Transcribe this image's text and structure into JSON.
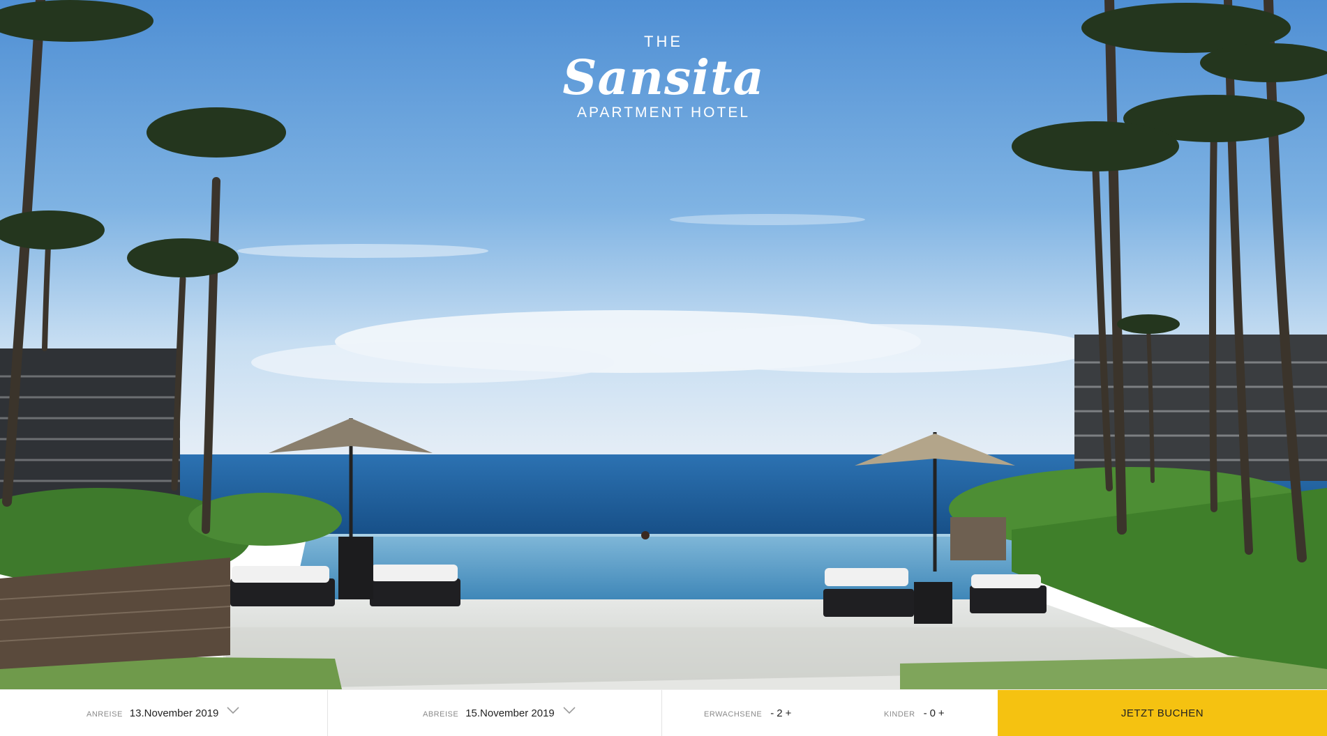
{
  "brand": {
    "the": "THE",
    "name": "Sansita",
    "subtitle": "APARTMENT HOTEL"
  },
  "booking": {
    "arrival_label": "ANREISE",
    "arrival_value": "13.November 2019",
    "departure_label": "ABREISE",
    "departure_value": "15.November 2019",
    "adults_label": "ERWACHSENE",
    "adults_minus": "-",
    "adults_value": "2",
    "adults_plus": "+",
    "children_label": "KINDER",
    "children_minus": "-",
    "children_value": "0",
    "children_plus": "+",
    "book_label": "JETZT BUCHEN"
  },
  "colors": {
    "accent": "#f5c211",
    "sky": "#6ea8dc",
    "sea": "#1f5f97"
  },
  "icons": {
    "dropdown": "chevron-down-icon"
  }
}
